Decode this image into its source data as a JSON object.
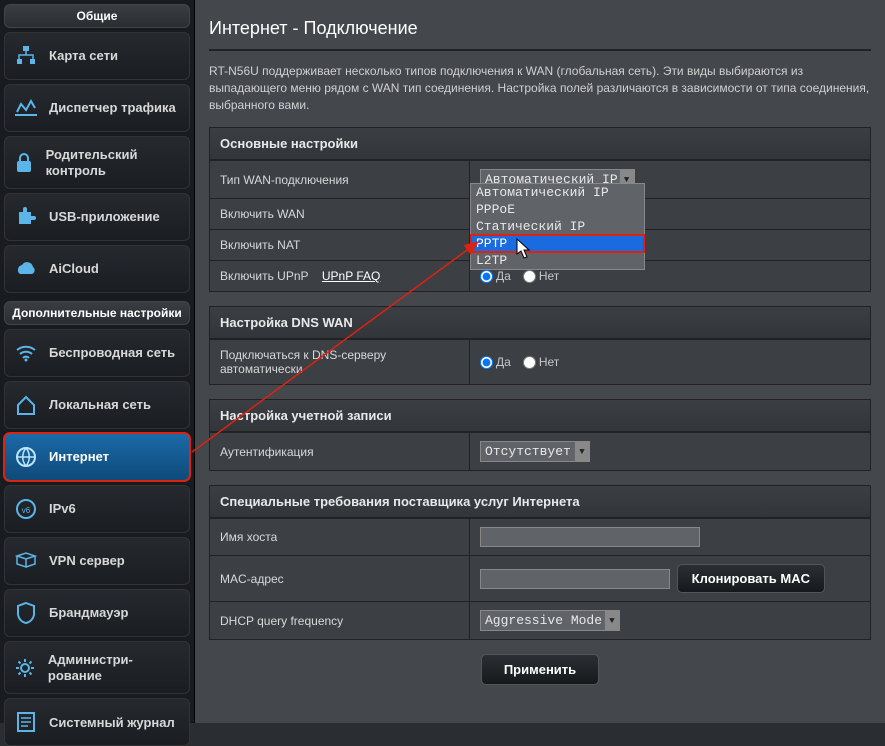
{
  "sidebar": {
    "general_header": "Общие",
    "advanced_header": "Дополнительные настройки",
    "items_general": [
      {
        "label": "Карта сети"
      },
      {
        "label": "Диспетчер трафика"
      },
      {
        "label": "Родительский контроль"
      },
      {
        "label": "USB-приложение"
      },
      {
        "label": "AiCloud"
      }
    ],
    "items_advanced": [
      {
        "label": "Беспроводная сеть"
      },
      {
        "label": "Локальная сеть"
      },
      {
        "label": "Интернет"
      },
      {
        "label": "IPv6"
      },
      {
        "label": "VPN сервер"
      },
      {
        "label": "Брандмауэр"
      },
      {
        "label": "Администри-рование"
      },
      {
        "label": "Системный журнал"
      }
    ]
  },
  "page": {
    "title": "Интернет - Подключение",
    "intro": "RT-N56U поддерживает несколько типов подключения к WAN (глобальная сеть). Эти виды выбираются из выпадающего меню рядом с WAN тип соединения. Настройка полей различаются в зависимости от типа соединения, выбранного вами.",
    "sections": {
      "basic": "Основные настройки",
      "dns": "Настройка DNS WAN",
      "account": "Настройка учетной записи",
      "isp": "Специальные требования поставщика услуг Интернета"
    },
    "labels": {
      "wan_type": "Тип WAN-подключения",
      "enable_wan": "Включить WAN",
      "enable_nat": "Включить NAT",
      "enable_upnp": "Включить UPnP",
      "upnp_faq": "UPnP FAQ",
      "dns_auto": "Подключаться к DNS-серверу автоматически",
      "auth": "Аутентификация",
      "hostname": "Имя хоста",
      "mac": "MAC-адрес",
      "clone_mac": "Клонировать MAC",
      "dhcp_freq": "DHCP query frequency",
      "apply": "Применить",
      "yes": "Да",
      "no": "Нет"
    },
    "values": {
      "wan_type_selected": "Автоматический IP",
      "wan_type_options": [
        "Автоматический IP",
        "PPPoE",
        "Статический IP",
        "PPTP",
        "L2TP"
      ],
      "auth_selected": "Отсутствует",
      "dhcp_freq_selected": "Aggressive Mode"
    }
  }
}
